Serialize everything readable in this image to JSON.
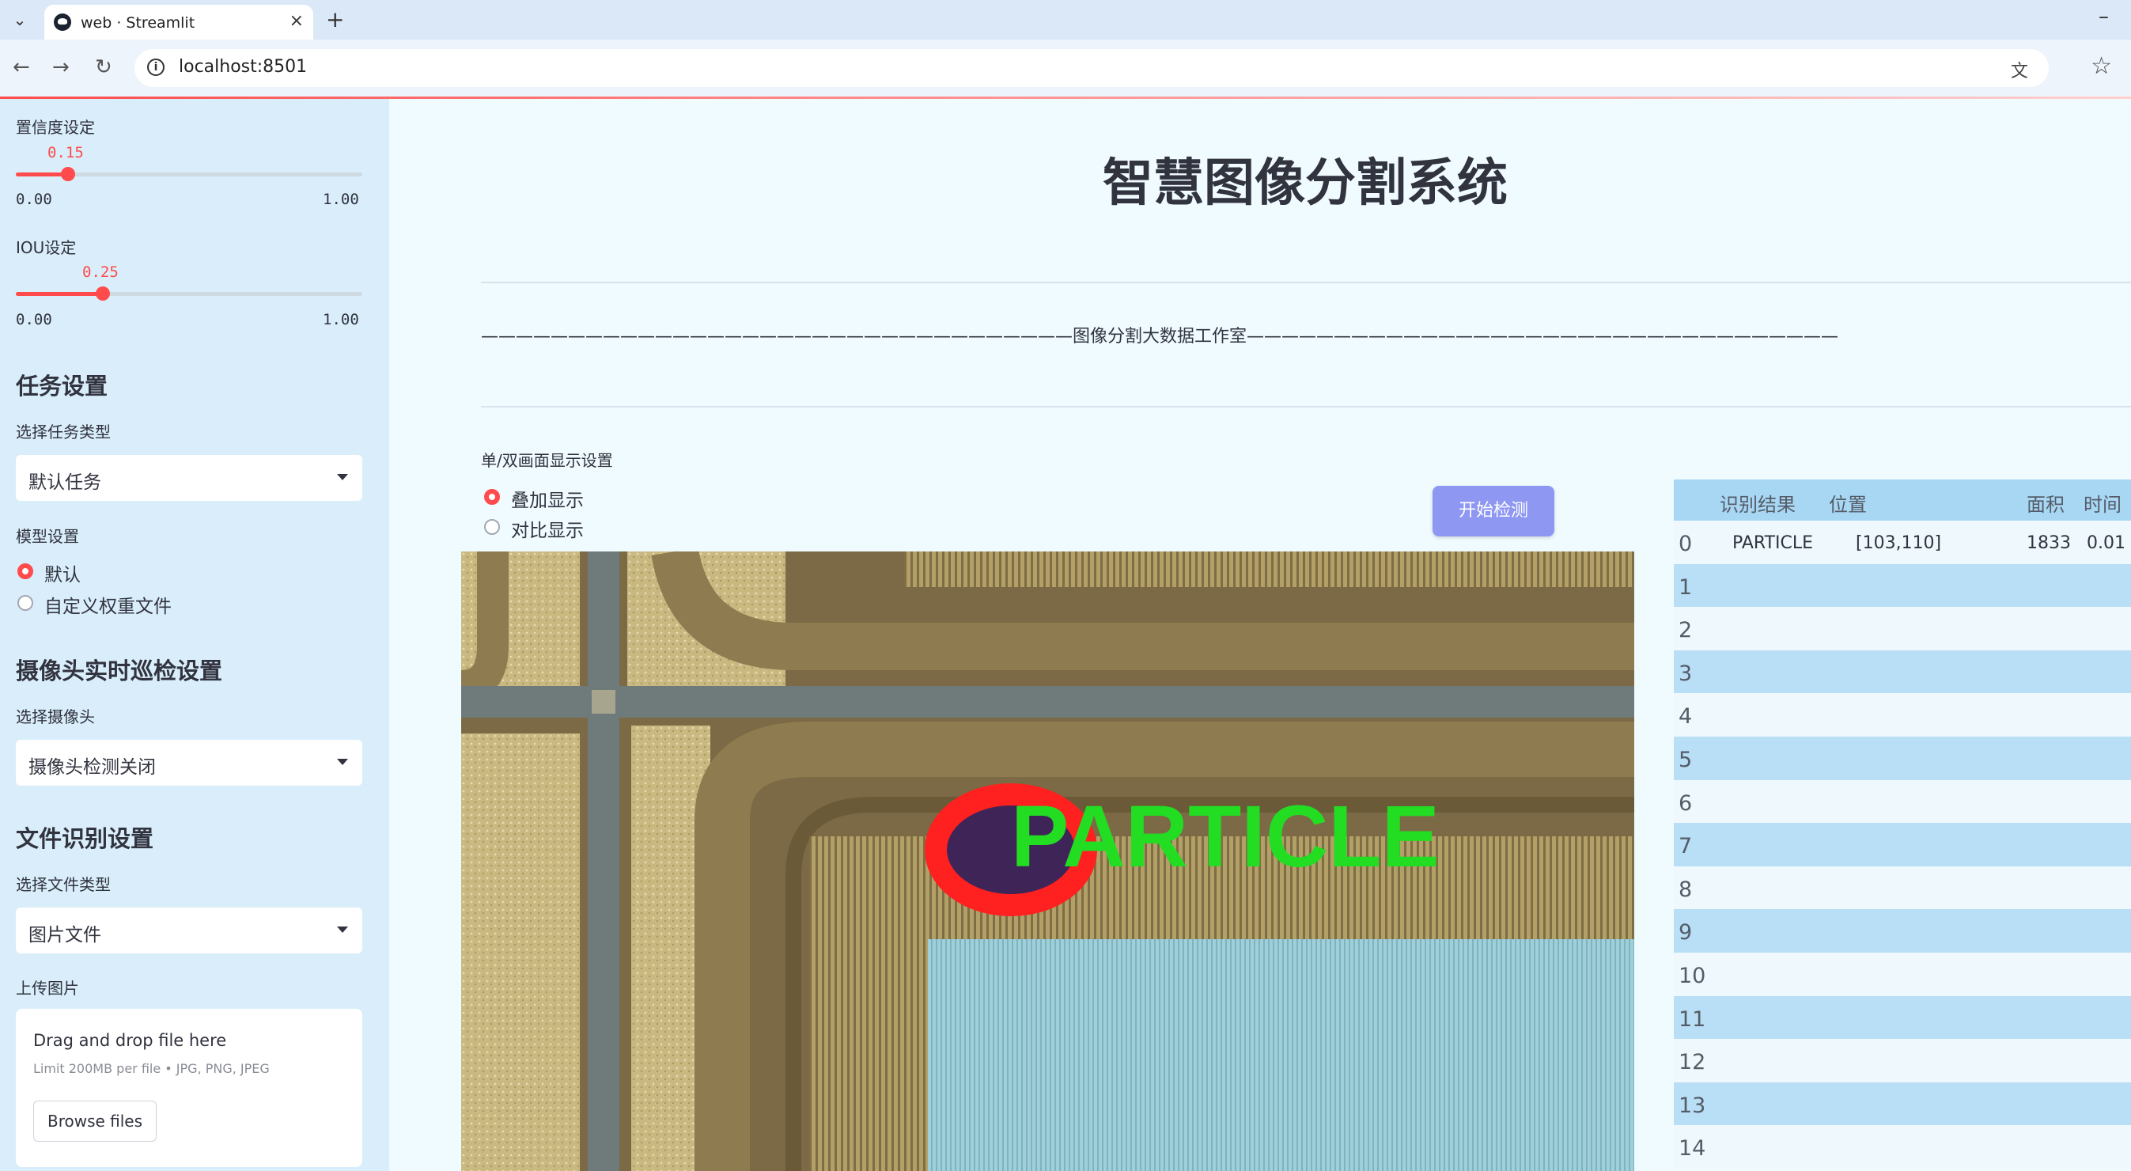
{
  "browser": {
    "tab_title": "web · Streamlit",
    "url": "localhost:8501"
  },
  "sidebar": {
    "confidence": {
      "label": "置信度设定",
      "value": 0.15,
      "value_text": "0.15",
      "min": "0.00",
      "max": "1.00"
    },
    "iou": {
      "label": "IOU设定",
      "value": 0.25,
      "value_text": "0.25",
      "min": "0.00",
      "max": "1.00"
    },
    "task_section": {
      "heading": "任务设置",
      "select_label": "选择任务类型",
      "selected": "默认任务"
    },
    "model_section": {
      "label": "模型设置",
      "options": [
        "默认",
        "自定义权重文件"
      ],
      "selected_index": 0
    },
    "camera_section": {
      "heading": "摄像头实时巡检设置",
      "select_label": "选择摄像头",
      "selected": "摄像头检测关闭"
    },
    "file_section": {
      "heading": "文件识别设置",
      "select_label": "选择文件类型",
      "selected": "图片文件"
    },
    "upload": {
      "label": "上传图片",
      "title": "Drag and drop file here",
      "limit": "Limit 200MB per file • JPG, PNG, JPEG",
      "button": "Browse files"
    }
  },
  "main": {
    "title": "智慧图像分割系统",
    "studio": "图像分割大数据工作室",
    "display_mode": {
      "label": "单/双画面显示设置",
      "options": [
        "叠加显示",
        "对比显示"
      ],
      "selected_index": 0
    },
    "start_button": "开始检测",
    "detection_label": "PARTICLE"
  },
  "results_table": {
    "headers": [
      "识别结果",
      "位置",
      "面积",
      "时间"
    ],
    "rows": [
      {
        "index": "0",
        "result": "PARTICLE",
        "position": "[103,110]",
        "area": "1833",
        "time": "0.01"
      },
      {
        "index": "1"
      },
      {
        "index": "2"
      },
      {
        "index": "3"
      },
      {
        "index": "4"
      },
      {
        "index": "5"
      },
      {
        "index": "6"
      },
      {
        "index": "7"
      },
      {
        "index": "8"
      },
      {
        "index": "9"
      },
      {
        "index": "10"
      },
      {
        "index": "11"
      },
      {
        "index": "12"
      },
      {
        "index": "13"
      },
      {
        "index": "14"
      }
    ]
  },
  "colors": {
    "accent": "#ff4b4b",
    "button": "#8e97f2",
    "sidebar_bg": "#d9eefa",
    "table_header": "#a8d7f4"
  }
}
